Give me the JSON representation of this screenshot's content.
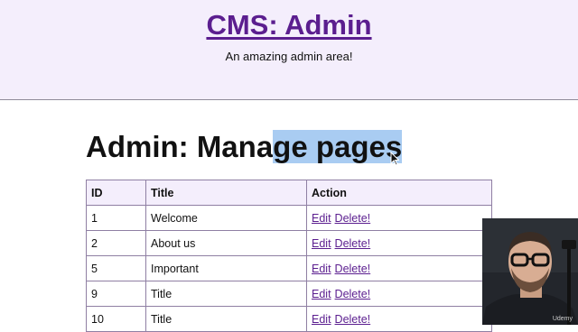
{
  "header": {
    "title": "CMS: Admin",
    "subtitle": "An amazing admin area!"
  },
  "main": {
    "heading_plain": "Admin: Mana",
    "heading_selected": "ge pages"
  },
  "table": {
    "columns": [
      "ID",
      "Title",
      "Action"
    ],
    "rows": [
      {
        "id": "1",
        "title": "Welcome",
        "edit": "Edit",
        "delete": "Delete!"
      },
      {
        "id": "2",
        "title": "About us",
        "edit": "Edit",
        "delete": "Delete!"
      },
      {
        "id": "5",
        "title": "Important",
        "edit": "Edit",
        "delete": "Delete!"
      },
      {
        "id": "9",
        "title": "Title",
        "edit": "Edit",
        "delete": "Delete!"
      },
      {
        "id": "10",
        "title": "Title",
        "edit": "Edit",
        "delete": "Delete!"
      }
    ]
  },
  "overlay": {
    "watermark": "Udemy"
  },
  "colors": {
    "header_bg": "#f4eefc",
    "link": "#5b1e8f",
    "selection": "#a9ccf2"
  }
}
